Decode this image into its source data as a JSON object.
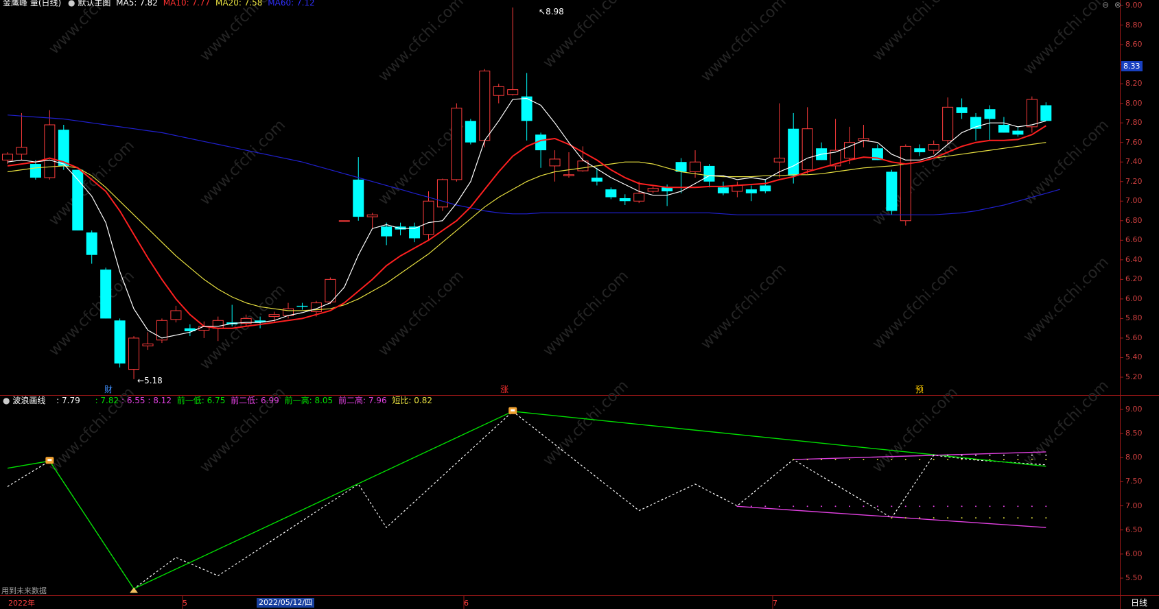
{
  "main_panel": {
    "header": {
      "title": "金鹰峰 量(日线)",
      "ma_label": "默认主图",
      "ma5": "MA5: 7.82",
      "ma10": "MA10: 7.77",
      "ma20": "MA20: 7.58",
      "ma60": "MA60: 7.12"
    },
    "current_price_tag": "8.33",
    "high_marker": "8.98",
    "low_marker": "5.18",
    "event_markers": [
      "财",
      "涨",
      "预"
    ],
    "y_ticks": [
      "9.00",
      "8.80",
      "8.60",
      "8.40",
      "8.20",
      "8.00",
      "7.80",
      "7.60",
      "7.40",
      "7.20",
      "7.00",
      "6.80",
      "6.60",
      "6.40",
      "6.20",
      "6.00",
      "5.80",
      "5.60",
      "5.40",
      "5.20"
    ]
  },
  "sub_panel": {
    "title": "波浪画线",
    "value": ": 7.79",
    "v1": ": 7.82",
    "v2": ": 6.55",
    "v3": ": 8.12",
    "prev_low1": "前一低: 6.75",
    "prev_low2": "前二低: 6.99",
    "prev_high1": "前一高: 8.05",
    "prev_high2": "前二高: 7.96",
    "short_ratio": "短比: 0.82",
    "y_ticks": [
      "9.00",
      "8.50",
      "8.00",
      "7.50",
      "7.00",
      "6.50",
      "6.00",
      "5.50"
    ],
    "footnote": "用到未来数据"
  },
  "time_axis": {
    "labels": [
      "2022年",
      "5",
      "2022/05/12/四",
      "6",
      "7"
    ],
    "period_button": "日线"
  },
  "colors": {
    "up": "#ff3c3c",
    "down": "#00ffff",
    "ma5": "#ffffff",
    "ma10": "#ff2020",
    "ma20": "#e8e040",
    "ma60": "#2020d0",
    "wave": "#00e000",
    "band": "#e040e0"
  },
  "chart_data": {
    "type": "candlestick",
    "candles": [
      {
        "o": 7.42,
        "h": 7.5,
        "l": 7.38,
        "c": 7.48
      },
      {
        "o": 7.48,
        "h": 7.9,
        "l": 7.42,
        "c": 7.55
      },
      {
        "o": 7.38,
        "h": 7.42,
        "l": 7.22,
        "c": 7.24
      },
      {
        "o": 7.24,
        "h": 7.93,
        "l": 7.22,
        "c": 7.78
      },
      {
        "o": 7.73,
        "h": 7.78,
        "l": 7.32,
        "c": 7.36
      },
      {
        "o": 7.32,
        "h": 7.32,
        "l": 6.7,
        "c": 6.7
      },
      {
        "o": 6.68,
        "h": 6.7,
        "l": 6.36,
        "c": 6.45
      },
      {
        "o": 6.3,
        "h": 6.32,
        "l": 5.8,
        "c": 5.8
      },
      {
        "o": 5.78,
        "h": 5.8,
        "l": 5.3,
        "c": 5.34
      },
      {
        "o": 5.28,
        "h": 5.62,
        "l": 5.18,
        "c": 5.6
      },
      {
        "o": 5.52,
        "h": 5.66,
        "l": 5.48,
        "c": 5.54
      },
      {
        "o": 5.58,
        "h": 5.8,
        "l": 5.55,
        "c": 5.78
      },
      {
        "o": 5.79,
        "h": 5.93,
        "l": 5.76,
        "c": 5.88
      },
      {
        "o": 5.7,
        "h": 5.74,
        "l": 5.62,
        "c": 5.67
      },
      {
        "o": 5.68,
        "h": 5.77,
        "l": 5.6,
        "c": 5.72
      },
      {
        "o": 5.7,
        "h": 5.82,
        "l": 5.57,
        "c": 5.78
      },
      {
        "o": 5.76,
        "h": 5.94,
        "l": 5.72,
        "c": 5.74
      },
      {
        "o": 5.75,
        "h": 5.84,
        "l": 5.72,
        "c": 5.8
      },
      {
        "o": 5.78,
        "h": 5.82,
        "l": 5.7,
        "c": 5.76
      },
      {
        "o": 5.82,
        "h": 5.87,
        "l": 5.76,
        "c": 5.84
      },
      {
        "o": 5.83,
        "h": 5.96,
        "l": 5.8,
        "c": 5.9
      },
      {
        "o": 5.93,
        "h": 5.96,
        "l": 5.89,
        "c": 5.92
      },
      {
        "o": 5.87,
        "h": 5.98,
        "l": 5.82,
        "c": 5.96
      },
      {
        "o": 5.97,
        "h": 6.22,
        "l": 5.95,
        "c": 6.2
      },
      {
        "o": 6.8,
        "h": 6.8,
        "l": 6.8,
        "c": 6.8
      },
      {
        "o": 7.22,
        "h": 7.45,
        "l": 6.8,
        "c": 6.84
      },
      {
        "o": 6.84,
        "h": 6.88,
        "l": 6.72,
        "c": 6.86
      },
      {
        "o": 6.74,
        "h": 6.78,
        "l": 6.55,
        "c": 6.64
      },
      {
        "o": 6.74,
        "h": 6.78,
        "l": 6.65,
        "c": 6.71
      },
      {
        "o": 6.74,
        "h": 6.78,
        "l": 6.58,
        "c": 6.62
      },
      {
        "o": 6.66,
        "h": 7.1,
        "l": 6.6,
        "c": 7.0
      },
      {
        "o": 6.94,
        "h": 7.23,
        "l": 6.9,
        "c": 7.22
      },
      {
        "o": 7.22,
        "h": 8.0,
        "l": 7.2,
        "c": 7.95
      },
      {
        "o": 7.82,
        "h": 7.84,
        "l": 7.58,
        "c": 7.6
      },
      {
        "o": 7.62,
        "h": 8.35,
        "l": 7.55,
        "c": 8.33
      },
      {
        "o": 8.08,
        "h": 8.2,
        "l": 8.0,
        "c": 8.17
      },
      {
        "o": 8.09,
        "h": 8.98,
        "l": 8.08,
        "c": 8.14
      },
      {
        "o": 8.07,
        "h": 8.31,
        "l": 7.62,
        "c": 7.82
      },
      {
        "o": 7.68,
        "h": 7.7,
        "l": 7.34,
        "c": 7.52
      },
      {
        "o": 7.36,
        "h": 7.52,
        "l": 7.2,
        "c": 7.43
      },
      {
        "o": 7.26,
        "h": 7.5,
        "l": 7.24,
        "c": 7.27
      },
      {
        "o": 7.31,
        "h": 7.56,
        "l": 7.3,
        "c": 7.41
      },
      {
        "o": 7.24,
        "h": 7.34,
        "l": 7.16,
        "c": 7.2
      },
      {
        "o": 7.12,
        "h": 7.14,
        "l": 7.02,
        "c": 7.04
      },
      {
        "o": 7.03,
        "h": 7.07,
        "l": 6.96,
        "c": 7.0
      },
      {
        "o": 7.0,
        "h": 7.2,
        "l": 6.98,
        "c": 7.08
      },
      {
        "o": 7.1,
        "h": 7.15,
        "l": 7.08,
        "c": 7.13
      },
      {
        "o": 7.14,
        "h": 7.17,
        "l": 6.95,
        "c": 7.1
      },
      {
        "o": 7.4,
        "h": 7.44,
        "l": 7.08,
        "c": 7.3
      },
      {
        "o": 7.3,
        "h": 7.52,
        "l": 7.24,
        "c": 7.4
      },
      {
        "o": 7.36,
        "h": 7.38,
        "l": 7.14,
        "c": 7.2
      },
      {
        "o": 7.14,
        "h": 7.2,
        "l": 7.06,
        "c": 7.08
      },
      {
        "o": 7.1,
        "h": 7.2,
        "l": 7.04,
        "c": 7.16
      },
      {
        "o": 7.12,
        "h": 7.16,
        "l": 7.0,
        "c": 7.08
      },
      {
        "o": 7.16,
        "h": 7.22,
        "l": 7.08,
        "c": 7.1
      },
      {
        "o": 7.4,
        "h": 8.0,
        "l": 7.24,
        "c": 7.44
      },
      {
        "o": 7.74,
        "h": 7.9,
        "l": 7.18,
        "c": 7.26
      },
      {
        "o": 7.32,
        "h": 7.96,
        "l": 7.28,
        "c": 7.74
      },
      {
        "o": 7.54,
        "h": 7.6,
        "l": 7.42,
        "c": 7.42
      },
      {
        "o": 7.36,
        "h": 7.84,
        "l": 7.32,
        "c": 7.52
      },
      {
        "o": 7.44,
        "h": 7.76,
        "l": 7.38,
        "c": 7.6
      },
      {
        "o": 7.62,
        "h": 7.78,
        "l": 7.55,
        "c": 7.64
      },
      {
        "o": 7.54,
        "h": 7.58,
        "l": 7.42,
        "c": 7.42
      },
      {
        "o": 7.3,
        "h": 7.32,
        "l": 6.86,
        "c": 6.9
      },
      {
        "o": 6.8,
        "h": 7.58,
        "l": 6.75,
        "c": 7.56
      },
      {
        "o": 7.54,
        "h": 7.58,
        "l": 7.46,
        "c": 7.5
      },
      {
        "o": 7.52,
        "h": 7.62,
        "l": 7.48,
        "c": 7.58
      },
      {
        "o": 7.62,
        "h": 8.06,
        "l": 7.58,
        "c": 7.96
      },
      {
        "o": 7.96,
        "h": 8.05,
        "l": 7.84,
        "c": 7.9
      },
      {
        "o": 7.86,
        "h": 7.9,
        "l": 7.62,
        "c": 7.74
      },
      {
        "o": 7.94,
        "h": 7.98,
        "l": 7.62,
        "c": 7.84
      },
      {
        "o": 7.78,
        "h": 7.86,
        "l": 7.7,
        "c": 7.7
      },
      {
        "o": 7.72,
        "h": 7.76,
        "l": 7.66,
        "c": 7.68
      },
      {
        "o": 7.76,
        "h": 8.07,
        "l": 7.7,
        "c": 8.04
      },
      {
        "o": 7.98,
        "h": 8.01,
        "l": 7.82,
        "c": 7.82
      }
    ],
    "ma5": [
      7.4,
      7.42,
      7.4,
      7.42,
      7.38,
      7.22,
      7.05,
      6.78,
      6.28,
      5.9,
      5.68,
      5.6,
      5.63,
      5.66,
      5.72,
      5.72,
      5.75,
      5.76,
      5.76,
      5.78,
      5.83,
      5.86,
      5.9,
      5.96,
      6.12,
      6.45,
      6.72,
      6.76,
      6.72,
      6.72,
      6.78,
      6.8,
      6.98,
      7.2,
      7.62,
      7.82,
      8.04,
      8.05,
      7.98,
      7.8,
      7.6,
      7.42,
      7.33,
      7.24,
      7.17,
      7.1,
      7.06,
      7.06,
      7.1,
      7.18,
      7.26,
      7.26,
      7.22,
      7.24,
      7.22,
      7.3,
      7.36,
      7.44,
      7.48,
      7.5,
      7.56,
      7.62,
      7.6,
      7.48,
      7.42,
      7.42,
      7.46,
      7.58,
      7.7,
      7.76,
      7.8,
      7.8,
      7.76,
      7.78,
      7.82
    ],
    "ma10": [
      7.36,
      7.38,
      7.4,
      7.44,
      7.4,
      7.34,
      7.22,
      7.1,
      6.9,
      6.66,
      6.42,
      6.2,
      6.0,
      5.84,
      5.72,
      5.7,
      5.7,
      5.72,
      5.74,
      5.76,
      5.78,
      5.8,
      5.84,
      5.88,
      5.96,
      6.08,
      6.2,
      6.34,
      6.44,
      6.52,
      6.6,
      6.7,
      6.8,
      6.94,
      7.12,
      7.3,
      7.46,
      7.56,
      7.62,
      7.64,
      7.58,
      7.5,
      7.42,
      7.32,
      7.24,
      7.18,
      7.16,
      7.14,
      7.14,
      7.14,
      7.15,
      7.15,
      7.16,
      7.17,
      7.18,
      7.22,
      7.25,
      7.3,
      7.34,
      7.38,
      7.42,
      7.45,
      7.44,
      7.4,
      7.38,
      7.4,
      7.44,
      7.5,
      7.56,
      7.6,
      7.62,
      7.62,
      7.63,
      7.68,
      7.77
    ],
    "ma20": [
      7.3,
      7.32,
      7.34,
      7.35,
      7.36,
      7.34,
      7.26,
      7.14,
      7.0,
      6.86,
      6.72,
      6.58,
      6.44,
      6.32,
      6.2,
      6.1,
      6.02,
      5.96,
      5.92,
      5.9,
      5.88,
      5.88,
      5.89,
      5.9,
      5.94,
      6.0,
      6.08,
      6.16,
      6.26,
      6.36,
      6.46,
      6.58,
      6.7,
      6.82,
      6.94,
      7.04,
      7.12,
      7.2,
      7.26,
      7.3,
      7.32,
      7.34,
      7.36,
      7.38,
      7.4,
      7.4,
      7.38,
      7.34,
      7.3,
      7.28,
      7.26,
      7.25,
      7.25,
      7.25,
      7.26,
      7.26,
      7.27,
      7.27,
      7.28,
      7.3,
      7.32,
      7.34,
      7.35,
      7.36,
      7.38,
      7.4,
      7.44,
      7.46,
      7.48,
      7.5,
      7.52,
      7.54,
      7.56,
      7.58,
      7.6
    ],
    "ma60": [
      7.88,
      7.87,
      7.86,
      7.85,
      7.84,
      7.82,
      7.8,
      7.78,
      7.76,
      7.74,
      7.72,
      7.7,
      7.67,
      7.64,
      7.61,
      7.58,
      7.55,
      7.52,
      7.49,
      7.46,
      7.43,
      7.4,
      7.36,
      7.32,
      7.28,
      7.24,
      7.2,
      7.16,
      7.12,
      7.08,
      7.04,
      7.0,
      6.96,
      6.93,
      6.9,
      6.88,
      6.87,
      6.87,
      6.88,
      6.88,
      6.88,
      6.88,
      6.88,
      6.88,
      6.88,
      6.88,
      6.88,
      6.88,
      6.88,
      6.88,
      6.88,
      6.87,
      6.86,
      6.86,
      6.86,
      6.86,
      6.86,
      6.86,
      6.86,
      6.86,
      6.86,
      6.86,
      6.86,
      6.86,
      6.86,
      6.86,
      6.86,
      6.87,
      6.88,
      6.9,
      6.93,
      6.96,
      7.0,
      7.04,
      7.08,
      7.12
    ],
    "sub_y_range": [
      5.2,
      9.2
    ],
    "wave_green": [
      [
        0,
        7.78
      ],
      [
        3,
        7.93
      ],
      [
        9,
        5.28
      ],
      [
        36,
        8.96
      ],
      [
        74,
        7.82
      ]
    ],
    "wave_dashed": [
      [
        0,
        7.4
      ],
      [
        3,
        7.93
      ],
      [
        9,
        5.28
      ],
      [
        12,
        5.93
      ],
      [
        15,
        5.55
      ],
      [
        25,
        7.45
      ],
      [
        27,
        6.55
      ],
      [
        36,
        8.96
      ],
      [
        45,
        6.9
      ],
      [
        49,
        7.45
      ],
      [
        52,
        7.0
      ],
      [
        56,
        7.96
      ],
      [
        63,
        6.75
      ],
      [
        66,
        8.05
      ],
      [
        69,
        7.95
      ],
      [
        74,
        7.85
      ]
    ],
    "band_upper": [
      [
        56,
        7.96
      ],
      [
        74,
        8.12
      ]
    ],
    "band_lower": [
      [
        52,
        6.99
      ],
      [
        74,
        6.55
      ]
    ]
  }
}
